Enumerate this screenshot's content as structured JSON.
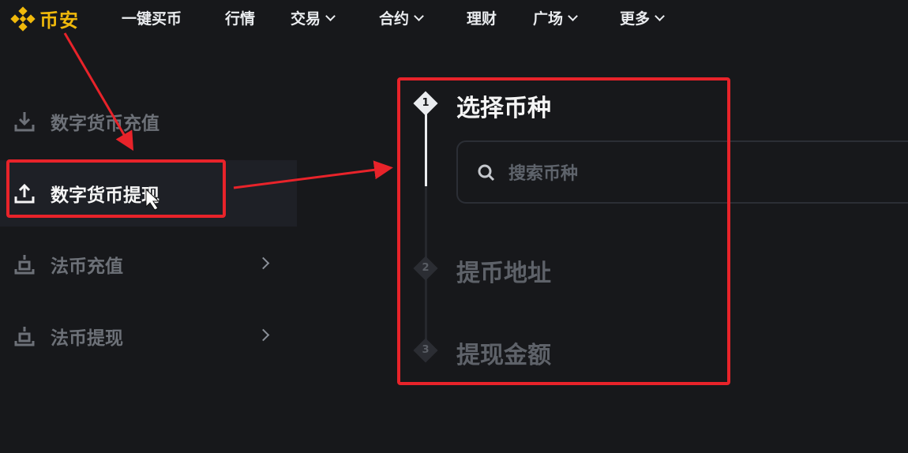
{
  "brand": {
    "name": "币安",
    "color": "#f0b90b"
  },
  "nav": {
    "items": [
      {
        "label": "一键买币",
        "dropdown": false
      },
      {
        "label": "行情",
        "dropdown": false
      },
      {
        "label": "交易",
        "dropdown": true
      },
      {
        "label": "合约",
        "dropdown": true
      },
      {
        "label": "理财",
        "dropdown": false
      },
      {
        "label": "广场",
        "dropdown": true
      },
      {
        "label": "更多",
        "dropdown": true
      }
    ]
  },
  "sidebar": {
    "items": [
      {
        "label": "数字货币充值",
        "icon": "download-icon",
        "active": false
      },
      {
        "label": "数字货币提现",
        "icon": "upload-icon",
        "active": true
      },
      {
        "label": "法币充值",
        "icon": "bank-deposit-icon",
        "active": false,
        "has_arrow": true
      },
      {
        "label": "法币提现",
        "icon": "bank-withdraw-icon",
        "active": false,
        "has_arrow": true
      }
    ]
  },
  "stepper": {
    "steps": [
      {
        "number": "1",
        "title": "选择币种",
        "active": true
      },
      {
        "number": "2",
        "title": "提币地址",
        "active": false
      },
      {
        "number": "3",
        "title": "提现金额",
        "active": false
      }
    ],
    "search_placeholder": "搜索币种"
  },
  "annotation": {
    "color": "#e8232a"
  }
}
